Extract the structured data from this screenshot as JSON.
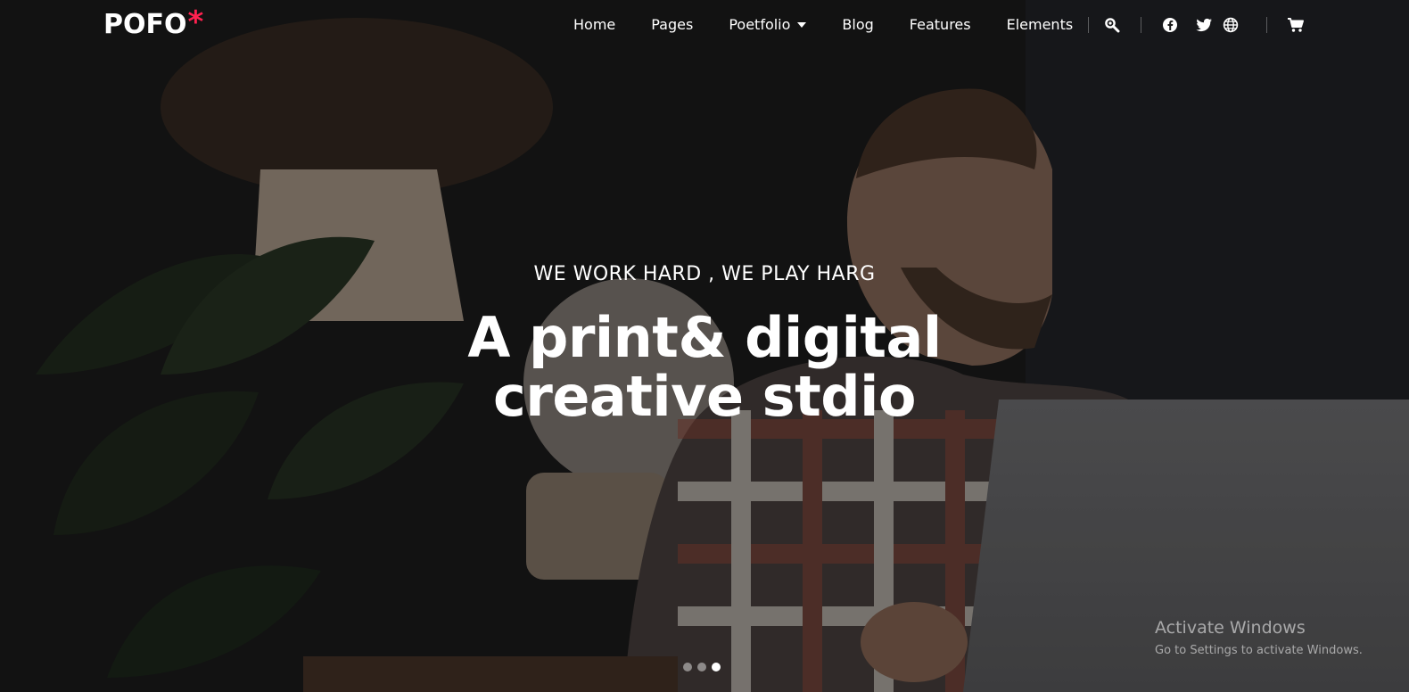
{
  "brand": {
    "name": "POFO",
    "asterisk": "*",
    "accent_color": "#ff214f"
  },
  "nav": {
    "items": [
      {
        "label": "Home"
      },
      {
        "label": "Pages"
      },
      {
        "label": "Poetfolio",
        "has_dropdown": true
      },
      {
        "label": "Blog"
      },
      {
        "label": "Features"
      },
      {
        "label": "Elements"
      }
    ],
    "icons": [
      "search-icon",
      "facebook-icon",
      "twitter-icon",
      "globe-icon",
      "cart-icon"
    ]
  },
  "hero": {
    "subtitle": "WE WORK HARD , WE PLAY HARG",
    "title_line1": "A print& digital",
    "title_line2": "creative stdio"
  },
  "slider": {
    "slide_count": 3,
    "active_index": 2
  },
  "watermark": {
    "title": "Activate Windows",
    "subtitle": "Go to Settings to activate Windows."
  }
}
